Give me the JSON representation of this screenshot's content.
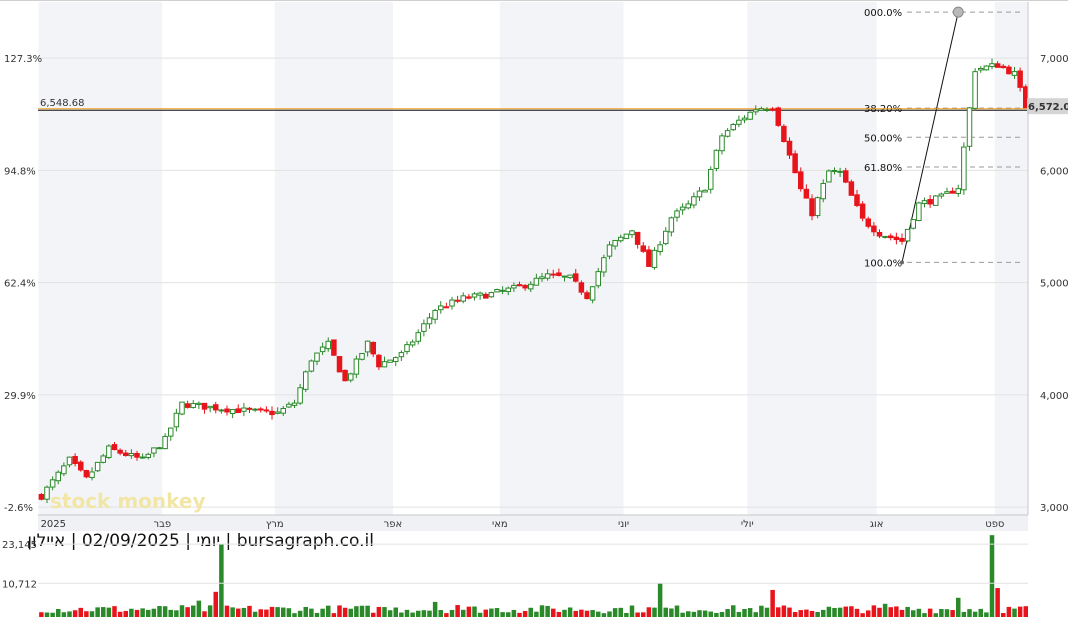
{
  "caption": "יומי | 02/09/2025 | איילון | bursagraph.co.il",
  "watermark": "stock monkey",
  "price_axis": {
    "ticks": [
      "3,000",
      "4,000",
      "5,000",
      "6,000",
      "7,000"
    ],
    "ylim": [
      2930,
      7500
    ],
    "current_label": "6,572.00"
  },
  "pct_axis": {
    "ticks": [
      "-2.6%",
      "29.9%",
      "62.4%",
      "94.8%",
      "127.3%"
    ]
  },
  "reference_line": {
    "label": "6,548.68",
    "value": 6548.68
  },
  "x_axis": {
    "month_labels": [
      "2025",
      "פבר",
      "מרץ",
      "אפר",
      "מאי",
      "יוני",
      "יולי",
      "אוג",
      "ספט"
    ],
    "month_starts": [
      0,
      22,
      42,
      63,
      82,
      104,
      126,
      149,
      170
    ],
    "total_days": 175
  },
  "fibonacci": {
    "levels": [
      {
        "label": "000.0%",
        "value": 7410
      },
      {
        "label": "38.20%",
        "value": 6555
      },
      {
        "label": "50.00%",
        "value": 6295
      },
      {
        "label": "61.80%",
        "value": 6030
      },
      {
        "label": "100.0%",
        "value": 5180
      }
    ],
    "anchor_low_index": 153,
    "anchor_high_index": 163
  },
  "volume_axis": {
    "ticks": [
      "10,712",
      "23,145"
    ],
    "ylim": [
      0,
      27000
    ]
  },
  "colors": {
    "up": "#2a8a2a",
    "down": "#e8141c",
    "ref_line": "#f0a020",
    "grid": "#e2e2e2",
    "band": "#f3f4f7"
  },
  "chart_data": {
    "type": "candlestick",
    "price_anchors": [
      [
        0,
        3100
      ],
      [
        5,
        3420
      ],
      [
        8,
        3250
      ],
      [
        12,
        3520
      ],
      [
        18,
        3420
      ],
      [
        22,
        3600
      ],
      [
        25,
        3920
      ],
      [
        30,
        3890
      ],
      [
        38,
        3850
      ],
      [
        42,
        3840
      ],
      [
        45,
        3930
      ],
      [
        48,
        4320
      ],
      [
        51,
        4450
      ],
      [
        54,
        4120
      ],
      [
        58,
        4460
      ],
      [
        60,
        4270
      ],
      [
        64,
        4360
      ],
      [
        66,
        4480
      ],
      [
        70,
        4760
      ],
      [
        75,
        4860
      ],
      [
        80,
        4900
      ],
      [
        85,
        4960
      ],
      [
        90,
        5060
      ],
      [
        94,
        5040
      ],
      [
        97,
        4880
      ],
      [
        101,
        5320
      ],
      [
        105,
        5470
      ],
      [
        108,
        5150
      ],
      [
        112,
        5580
      ],
      [
        115,
        5690
      ],
      [
        118,
        5850
      ],
      [
        121,
        6310
      ],
      [
        124,
        6440
      ],
      [
        127,
        6550
      ],
      [
        130,
        6570
      ],
      [
        132,
        6280
      ],
      [
        135,
        5830
      ],
      [
        137,
        5620
      ],
      [
        140,
        5990
      ],
      [
        142,
        5980
      ],
      [
        146,
        5560
      ],
      [
        149,
        5440
      ],
      [
        153,
        5370
      ],
      [
        156,
        5700
      ],
      [
        160,
        5760
      ],
      [
        163,
        5850
      ],
      [
        166,
        6900
      ],
      [
        170,
        6940
      ],
      [
        173,
        6860
      ],
      [
        175,
        6572
      ]
    ],
    "volume_spikes": [
      [
        32,
        23145
      ],
      [
        31,
        8000
      ],
      [
        28,
        5200
      ],
      [
        70,
        4800
      ],
      [
        110,
        10712
      ],
      [
        130,
        8600
      ],
      [
        169,
        26000
      ],
      [
        170,
        9200
      ],
      [
        163,
        6100
      ],
      [
        150,
        4200
      ],
      [
        60,
        3200
      ],
      [
        74,
        3800
      ]
    ]
  }
}
